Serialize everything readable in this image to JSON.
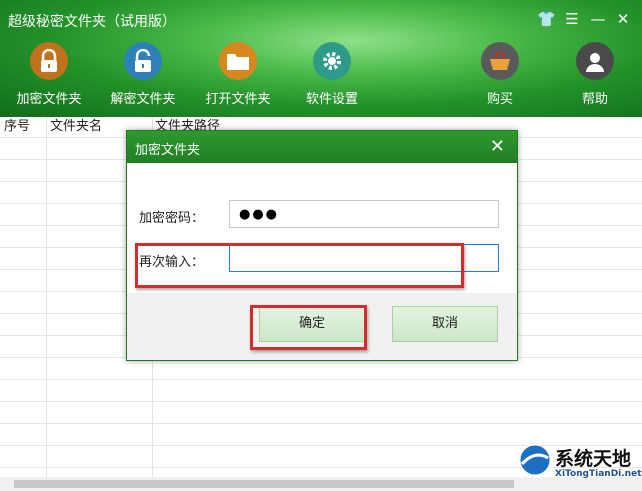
{
  "app": {
    "title": "超级秘密文件夹（试用版）",
    "controls": [
      "👕",
      "☰",
      "—",
      "✕"
    ]
  },
  "toolbar": {
    "encrypt": "加密文件夹",
    "decrypt": "解密文件夹",
    "open": "打开文件夹",
    "settings": "软件设置",
    "buy": "购买",
    "help": "帮助"
  },
  "table": {
    "headers": [
      "序号",
      "文件夹名",
      "文件夹路径"
    ]
  },
  "dialog": {
    "title": "加密文件夹",
    "close": "✕",
    "password_label": "加密密码：",
    "password_value": "●●●",
    "confirm_label": "再次输入：",
    "confirm_value": "",
    "ok": "确定",
    "cancel": "取消"
  },
  "watermark": {
    "brand": "系统天地",
    "url": "XiTongTianDi.net"
  },
  "colors": {
    "header_green": "#23922a",
    "dialog_title": "#2e9a30",
    "highlight_red": "#d42b2b"
  }
}
